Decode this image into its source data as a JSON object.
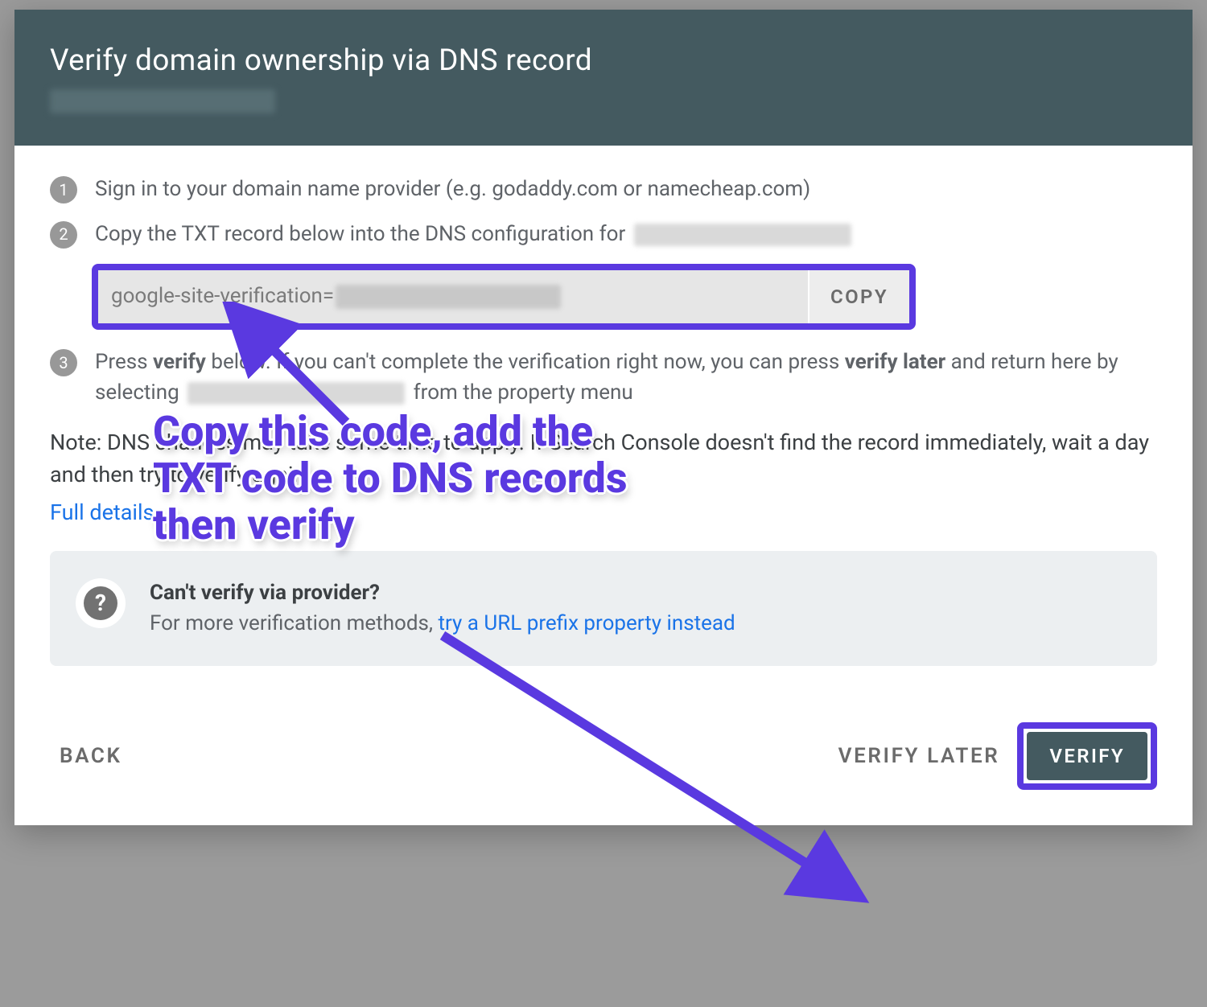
{
  "header": {
    "title": "Verify domain ownership via DNS record"
  },
  "steps": {
    "s1": {
      "num": "1",
      "text": "Sign in to your domain name provider (e.g. godaddy.com or namecheap.com)"
    },
    "s2": {
      "num": "2",
      "text": "Copy the TXT record below into the DNS configuration for "
    },
    "s3": {
      "num": "3",
      "part1": "Press ",
      "bold1": "verify",
      "part2": " below. If you can't complete the verification right now, you can press ",
      "bold2": "verify later",
      "part3": " and return here by selecting ",
      "part4": " from the property menu"
    }
  },
  "txt_record": {
    "prefix": "google-site-verification=",
    "copy_label": "COPY"
  },
  "note": {
    "line_a": "Note: DNS changes may take some time to apply. If Search Console doesn't find the record immediately, wait a day and then try to verify again",
    "full_details": "Full details"
  },
  "hint": {
    "title_a": "Can't verify via ",
    "title_b": " provider?",
    "sub_a": "For more verification methods, ",
    "link": "try a URL prefix property instead"
  },
  "footer": {
    "back": "BACK",
    "verify_later": "VERIFY LATER",
    "verify": "VERIFY"
  },
  "annotation": {
    "line1": "Copy this code, add the",
    "line2": "TXT code to DNS records",
    "line3": "then verify"
  }
}
